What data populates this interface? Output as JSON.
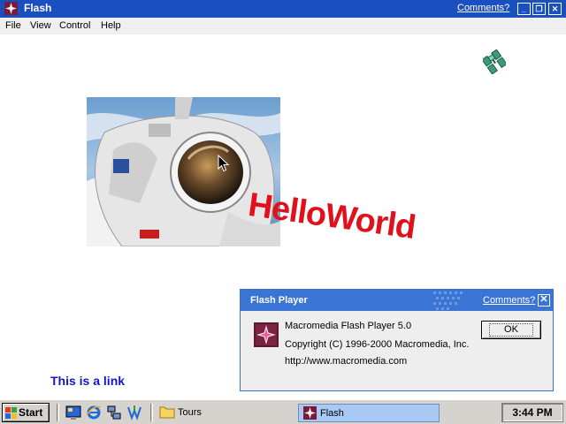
{
  "window": {
    "title": "Flash",
    "comments_link": "Comments?",
    "minimize_glyph": "_",
    "restore_glyph": "❐",
    "close_glyph": "✕"
  },
  "menu": {
    "items": [
      {
        "label": "File"
      },
      {
        "label": "View"
      },
      {
        "label": "Control"
      },
      {
        "label": "Help"
      }
    ]
  },
  "stage": {
    "hello_text": "HelloWorld",
    "link_text": "This is a link",
    "image_subject": "astronaut-photo"
  },
  "dialog": {
    "title": "Flash Player",
    "comments_link": "Comments?",
    "close_glyph": "✕",
    "lines": [
      "Macromedia Flash Player 5.0",
      "Copyright (C) 1996-2000 Macromedia, Inc.",
      "http://www.macromedia.com"
    ],
    "ok_label": "OK"
  },
  "taskbar": {
    "start_label": "Start",
    "quicklaunch": [
      "desktop-icon",
      "ie-icon",
      "network-icon",
      "outlook-icon"
    ],
    "tours_label": "Tours",
    "task_label": "Flash",
    "clock": "3:44 PM"
  },
  "colors": {
    "titlebar": "#1a4fc0",
    "dialog_titlebar": "#3a74d4",
    "hello": "#e0101c",
    "link": "#1515c8",
    "active_task": "#a9c9f5"
  }
}
